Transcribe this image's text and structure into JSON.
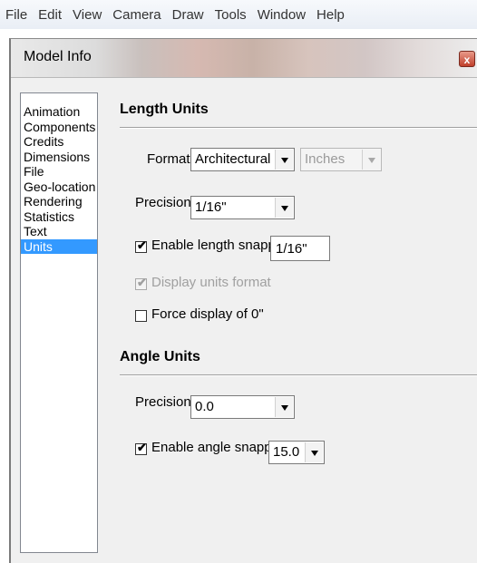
{
  "menubar": {
    "items": [
      "File",
      "Edit",
      "View",
      "Camera",
      "Draw",
      "Tools",
      "Window",
      "Help"
    ]
  },
  "dialog": {
    "title": "Model Info",
    "close_glyph": "x"
  },
  "nav": {
    "items": [
      {
        "label": "Animation",
        "selected": false
      },
      {
        "label": "Components",
        "selected": false
      },
      {
        "label": "Credits",
        "selected": false
      },
      {
        "label": "Dimensions",
        "selected": false
      },
      {
        "label": "File",
        "selected": false
      },
      {
        "label": "Geo-location",
        "selected": false
      },
      {
        "label": "Rendering",
        "selected": false
      },
      {
        "label": "Statistics",
        "selected": false
      },
      {
        "label": "Text",
        "selected": false
      },
      {
        "label": "Units",
        "selected": true
      }
    ]
  },
  "length_units": {
    "heading": "Length Units",
    "format_label": "Format:",
    "format_value": "Architectural",
    "unit_value": "Inches",
    "precision_label": "Precision:",
    "precision_value": "1/16\"",
    "enable_snapping": {
      "label": "Enable length snapping",
      "checked": true,
      "value": "1/16\""
    },
    "display_units_format": {
      "label": "Display units format",
      "checked": true,
      "disabled": true
    },
    "force_display_zero": {
      "label": "Force display of 0\"",
      "checked": false
    }
  },
  "angle_units": {
    "heading": "Angle Units",
    "precision_label": "Precision:",
    "precision_value": "0.0",
    "enable_snapping": {
      "label": "Enable angle snapping",
      "checked": true,
      "value": "15.0"
    }
  },
  "glyphs": {
    "check": "✔"
  },
  "colors": {
    "selection": "#3399ff",
    "dialog_bg": "#f0f0f0",
    "close_button": "#c0402b"
  }
}
